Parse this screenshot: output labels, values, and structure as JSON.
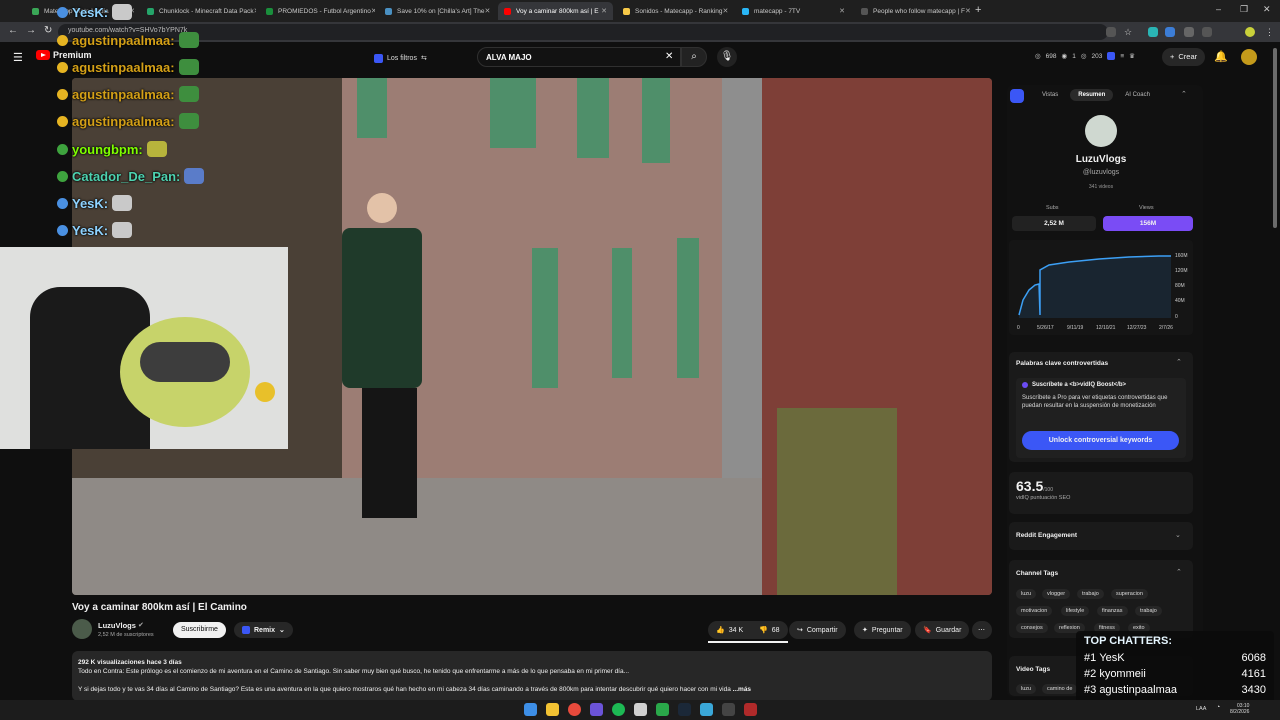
{
  "browser": {
    "tabs": [
      {
        "label": "Matecapp Stats Media",
        "color": "#3aa757"
      },
      {
        "label": "Chunklock - Minecraft Data Pack",
        "color": "#25a56a"
      },
      {
        "label": "PROMIEDOS - Futbol Argentino",
        "color": "#1a8f3c"
      },
      {
        "label": "Save 10% on [Chilla's Art] The",
        "color": "#1b2838"
      },
      {
        "label": "Voy a caminar 800km así | E",
        "color": "#ff0000"
      },
      {
        "label": "Sonidos - Matecapp - Ranking",
        "color": "#f7c948"
      },
      {
        "label": "matecapp - 7TV",
        "color": "#29b6f6"
      },
      {
        "label": "People who follow matecapp | F",
        "color": "#333333"
      }
    ],
    "url": "youtube.com/watch?v=SHVo7bYPN7k"
  },
  "youtube": {
    "logo": "Premium",
    "filters_label": "Los filtros",
    "search_value": "ALVA MAJO",
    "stats": [
      "698",
      "1",
      "203"
    ],
    "create_label": "Crear"
  },
  "chat": [
    {
      "user": "YesK:",
      "color": "#8fd3ff"
    },
    {
      "user": "agustinpaalmaa:",
      "color": "#d4a017"
    },
    {
      "user": "agustinpaalmaa:",
      "color": "#d4a017"
    },
    {
      "user": "agustinpaalmaa:",
      "color": "#d4a017"
    },
    {
      "user": "agustinpaalmaa:",
      "color": "#d4a017"
    },
    {
      "user": "youngbpm:",
      "color": "#7fff00"
    },
    {
      "user": "Catador_De_Pan:",
      "color": "#4dd2b0"
    },
    {
      "user": "YesK:",
      "color": "#8fd3ff"
    },
    {
      "user": "YesK:",
      "color": "#8fd3ff"
    }
  ],
  "video": {
    "title": "Voy a caminar 800km así | El Camino",
    "channel": "LuzuVlogs",
    "subscribers": "2,52 M de suscriptores",
    "subscribe_label": "Suscribirme",
    "remix_label": "Remix",
    "likes": "34 K",
    "dislikes": "68",
    "share_label": "Compartir",
    "ask_label": "Preguntar",
    "save_label": "Guardar",
    "desc_meta": "292 K visualizaciones  hace 3 días",
    "desc_line1": "Todo en Contra: Este prólogo es el comienzo de mi aventura en el Camino de Santiago. Sin saber muy bien qué busco, he tenido que enfrentarme a más de lo que pensaba en mi primer día...",
    "desc_line2": "Y si dejas todo y te vas 34 días al Camino de Santiago? Esta es una aventura en la que quiero mostraros qué han hecho en mi cabeza 34 días caminando a través de 800km para intentar descubrir qué quiero hacer con mi vida",
    "desc_more": "...más"
  },
  "panel": {
    "tabs": [
      "Vistas",
      "Resumen",
      "AI Coach"
    ],
    "channel_name": "LuzuVlogs",
    "handle": "@luzuvlogs",
    "videos": "341 videos",
    "subs_label": "Subs",
    "views_label": "Views",
    "subs_value": "2,52 M",
    "views_value": "156M",
    "chart_y": [
      "160M",
      "120M",
      "80M",
      "40M",
      "0"
    ],
    "chart_x": [
      "0",
      "5/26/17",
      "9/11/19",
      "12/10/21",
      "12/27/23",
      "2/7/26"
    ],
    "keywords_title": "Palabras clave controvertidas",
    "pro_title": "Suscríbete a <b>vidIQ Boost</b>",
    "pro_text": "Suscríbete a Pro para ver etiquetas controvertidas que puedan resultar en la suspensión de monetización",
    "unlock_label": "Unlock controversial keywords",
    "seo_score": "63.5",
    "seo_max": "/100",
    "seo_label": "vidIQ puntuación SEO",
    "reddit_label": "Reddit Engagement",
    "channel_tags_label": "Channel Tags",
    "tags": [
      "luzu",
      "vlogger",
      "trabajo",
      "superacion",
      "motivacion",
      "lifestyle",
      "finanzas",
      "trabajo",
      "consejos",
      "reflexion",
      "fitness",
      "exito"
    ],
    "video_tags_label": "Video Tags",
    "video_tags": [
      "luzu",
      "camino de"
    ]
  },
  "top_chatters": {
    "title": "TOP CHATTERS:",
    "rows": [
      {
        "rank": "#1",
        "name": "YesK",
        "count": "6068"
      },
      {
        "rank": "#2",
        "name": "kyommeii",
        "count": "4161"
      },
      {
        "rank": "#3",
        "name": "agustinpaalmaa",
        "count": "3430"
      }
    ]
  },
  "taskbar": {
    "lang": "LAA",
    "time": "03:10",
    "date": "8/2/2026"
  }
}
